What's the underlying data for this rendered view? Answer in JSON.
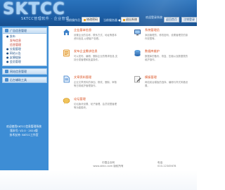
{
  "header": {
    "logo": "SKTCC",
    "slogan": "SKTCC管理软件 · 企业管理",
    "nav_left": "当前操作员: 管理员",
    "nav_mid": "当前服务器 ●在线",
    "chip1": "修改密码",
    "chip2": "退出系统",
    "top_text": "欢迎登录系统",
    "top_btn1": "返回首页",
    "top_btn2": "注销登录"
  },
  "sidebar": {
    "panel1_title": "广告信息管理",
    "items": [
      {
        "label": "● 发布"
      },
      {
        "label": "发布信息",
        "sub": true
      },
      {
        "label": "信息管理",
        "sub": true
      },
      {
        "label": "● 分类管理"
      },
      {
        "label": "● 网站公告"
      },
      {
        "label": "● 友情链接"
      },
      {
        "label": "● 会员管理"
      }
    ],
    "panel2_title": "网站信息管理",
    "panel3_title": "后台辅助工具",
    "notice_lines": [
      "欢迎使用SKTCC信息管理系统",
      "版本号: V2.0 · 2024版",
      "技术支持: SKTCC工作室"
    ]
  },
  "features": [
    {
      "title": "企业基本信息",
      "desc": "设置企业的名称、联系方式、地址等基本资料信息,以便客户查看。",
      "icon": "home-icon",
      "color": "#3a7fc8"
    },
    {
      "title": "发布企业需求信息",
      "desc": "可以发布、编辑、删除企业的需求信息,支持分类管理和批量操作。",
      "icon": "list-icon",
      "color": "#e08a1e"
    },
    {
      "title": "文章资料管理",
      "desc": "企业文章资料的添加、修改、删除、审核等日常维护管理操作。",
      "icon": "document-icon",
      "color": "#3a7fc8"
    },
    {
      "title": "论坛管理",
      "desc": "论坛版块设置、帖子管理、会员权限管理等功能模块。",
      "icon": "chat-icon",
      "color": "#e0a01e"
    },
    {
      "title": "系统管理员",
      "desc": "添加管理员、修改密码、设置管理员的操作权限等。",
      "icon": "user-icon",
      "color": "#3a7fc8"
    },
    {
      "title": "数据库维护",
      "desc": "数据库的备份、恢复、压缩以及数据表的维护操作。",
      "icon": "database-icon",
      "color": "#2f6fb5"
    },
    {
      "title": "模板管理",
      "desc": "网站前台模板的选择、编辑与样式风格设置。",
      "icon": "edit-icon",
      "color": "#5a5a5a"
    }
  ],
  "footer": {
    "line1": "中国企业网",
    "line2": "www.sktcc.com 版权所有",
    "right_label": "电话",
    "right_value": "010-12345678"
  }
}
